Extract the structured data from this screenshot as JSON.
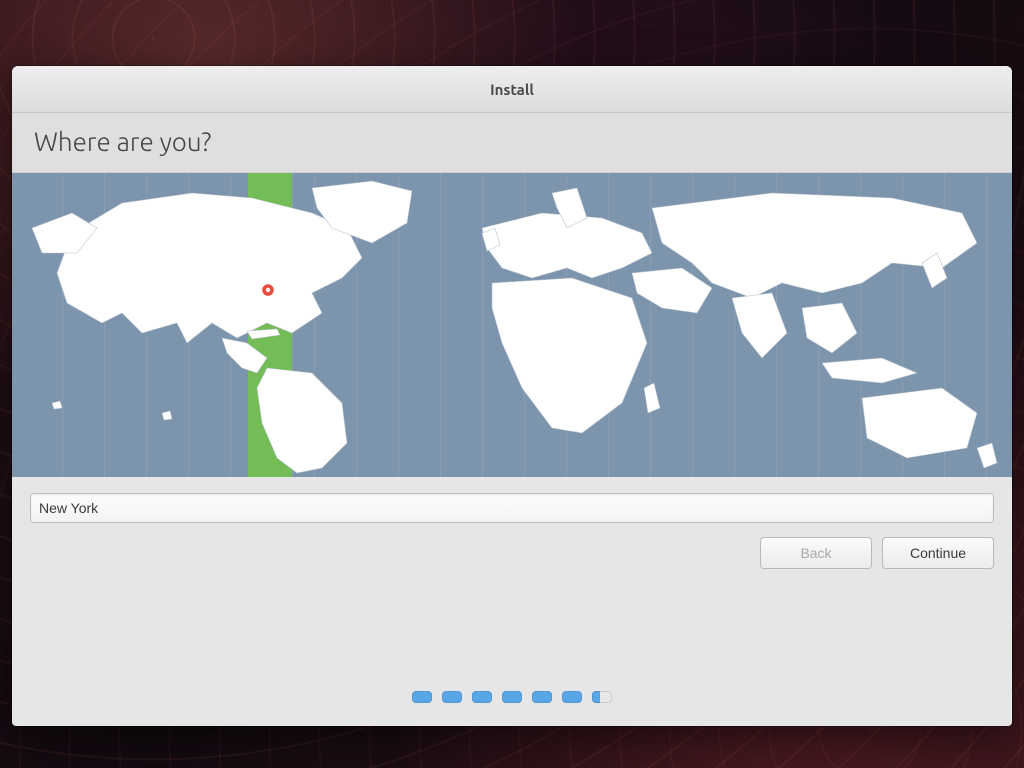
{
  "window": {
    "title": "Install"
  },
  "page": {
    "heading": "Where are you?"
  },
  "map": {
    "selected_timezone": "America/New_York",
    "selected_band": {
      "left_pct": 23.6,
      "width_pct": 4.4
    },
    "pin": {
      "x_pct": 25.6,
      "y_pct": 38.5
    },
    "tz_line_positions_pct": [
      5,
      9.2,
      13.4,
      17.6,
      21.8,
      23.6,
      28,
      30.2,
      34.4,
      38.6,
      42.8,
      47,
      51.2,
      55.4,
      59.6,
      63.8,
      68,
      72.2,
      76.4,
      80.6,
      84.8,
      89,
      93.2,
      97.4
    ]
  },
  "location_input": {
    "value": "New York",
    "placeholder": ""
  },
  "buttons": {
    "back": "Back",
    "continue": "Continue",
    "back_enabled": false
  },
  "progress": {
    "total": 7,
    "filled": 6
  }
}
